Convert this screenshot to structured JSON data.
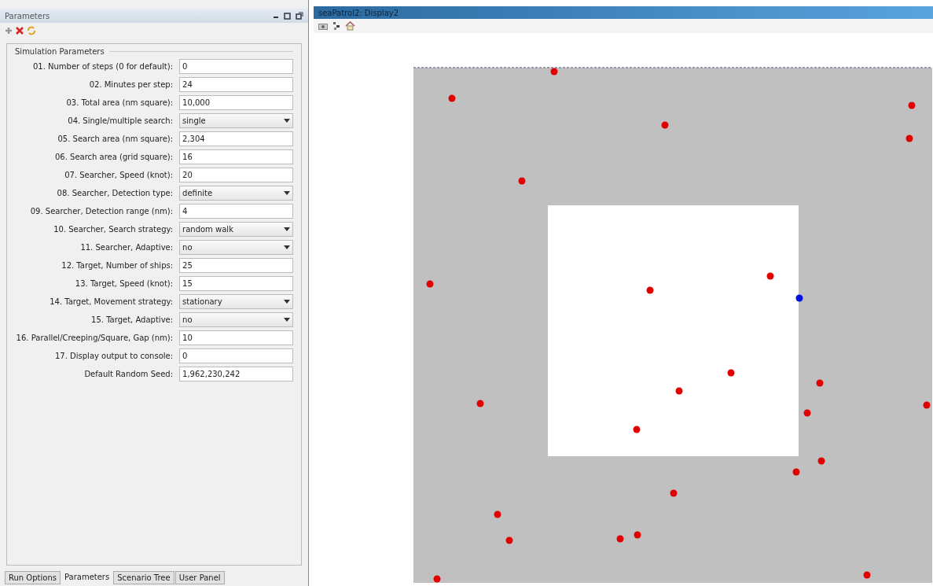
{
  "parameters_panel": {
    "title": "Parameters",
    "group_title": "Simulation Parameters",
    "fields": [
      {
        "label": "01. Number of steps (0 for default):",
        "value": "0",
        "kind": "text"
      },
      {
        "label": "02. Minutes per step:",
        "value": "24",
        "kind": "text"
      },
      {
        "label": "03. Total area (nm square):",
        "value": "10,000",
        "kind": "text"
      },
      {
        "label": "04. Single/multiple search:",
        "value": "single",
        "kind": "select"
      },
      {
        "label": "05. Search area (nm square):",
        "value": "2,304",
        "kind": "text"
      },
      {
        "label": "06. Search area (grid square):",
        "value": "16",
        "kind": "text"
      },
      {
        "label": "07. Searcher, Speed (knot):",
        "value": "20",
        "kind": "text"
      },
      {
        "label": "08. Searcher, Detection type:",
        "value": "definite",
        "kind": "select"
      },
      {
        "label": "09. Searcher, Detection range (nm):",
        "value": "4",
        "kind": "text"
      },
      {
        "label": "10. Searcher, Search strategy:",
        "value": "random walk",
        "kind": "select"
      },
      {
        "label": "11. Searcher, Adaptive:",
        "value": "no",
        "kind": "select"
      },
      {
        "label": "12. Target, Number of ships:",
        "value": "25",
        "kind": "text"
      },
      {
        "label": "13. Target, Speed (knot):",
        "value": "15",
        "kind": "text"
      },
      {
        "label": "14. Target, Movement strategy:",
        "value": "stationary",
        "kind": "select"
      },
      {
        "label": "15. Target, Adaptive:",
        "value": "no",
        "kind": "select"
      },
      {
        "label": "16. Parallel/Creeping/Square, Gap (nm):",
        "value": "10",
        "kind": "text"
      },
      {
        "label": "17. Display output to console:",
        "value": "0",
        "kind": "text"
      },
      {
        "label": "Default Random Seed:",
        "value": "1,962,230,242",
        "kind": "text"
      }
    ],
    "tabs": [
      {
        "label": "Run Options",
        "selected": false
      },
      {
        "label": "Parameters",
        "selected": true
      },
      {
        "label": "Scenario Tree",
        "selected": false
      },
      {
        "label": "User Panel",
        "selected": false
      }
    ]
  },
  "display": {
    "title": "seaPatrol2: Display2"
  }
}
